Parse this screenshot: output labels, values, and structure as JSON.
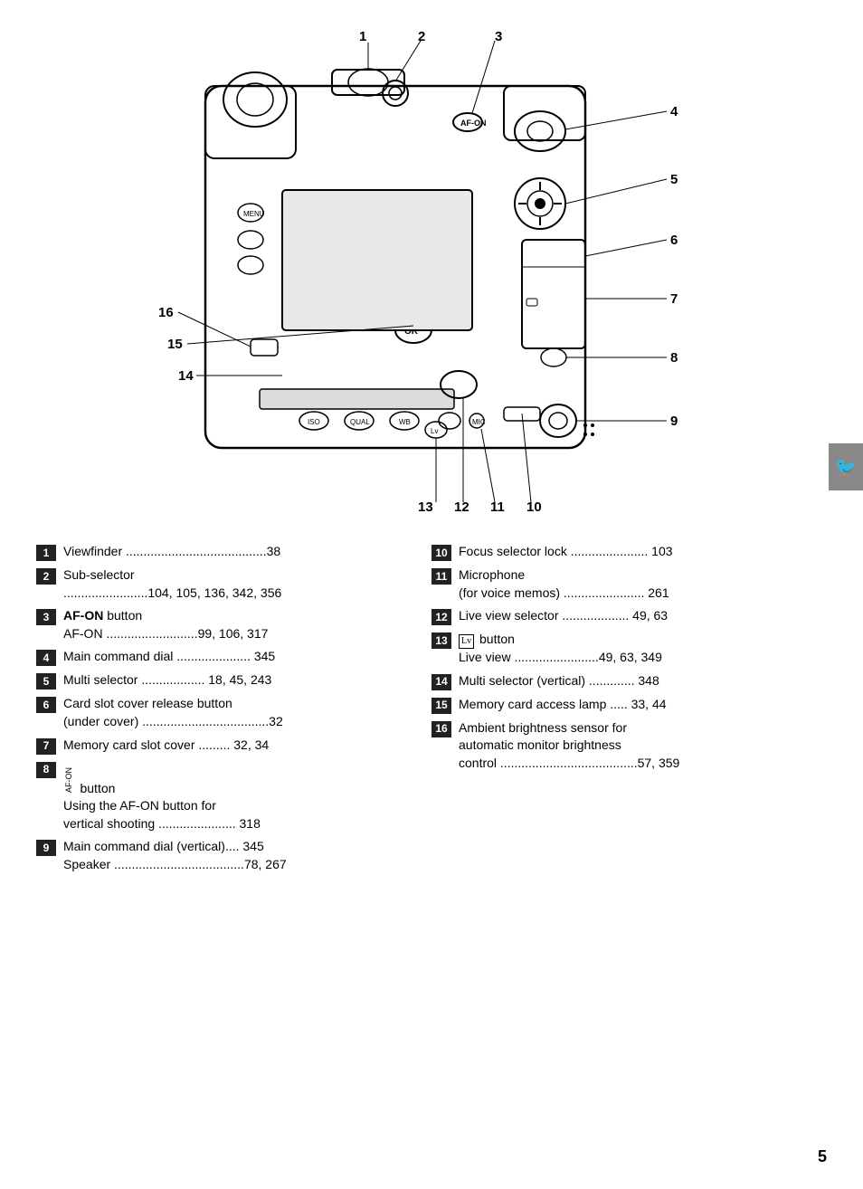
{
  "diagram": {
    "labels": [
      {
        "id": "1",
        "text": "1"
      },
      {
        "id": "2",
        "text": "2"
      },
      {
        "id": "3",
        "text": "3"
      },
      {
        "id": "4",
        "text": "4"
      },
      {
        "id": "5",
        "text": "5"
      },
      {
        "id": "6",
        "text": "6"
      },
      {
        "id": "7",
        "text": "7"
      },
      {
        "id": "8",
        "text": "8"
      },
      {
        "id": "9",
        "text": "9"
      },
      {
        "id": "10",
        "text": "10"
      },
      {
        "id": "11",
        "text": "11"
      },
      {
        "id": "12",
        "text": "12"
      },
      {
        "id": "13",
        "text": "13"
      },
      {
        "id": "14",
        "text": "14"
      },
      {
        "id": "15",
        "text": "15"
      },
      {
        "id": "16",
        "text": "16"
      }
    ]
  },
  "parts": [
    {
      "number": "1",
      "text": "Viewfinder ........................................38"
    },
    {
      "number": "2",
      "text": "Sub-selector\n........................104, 105, 136, 342, 356"
    },
    {
      "number": "3",
      "text": "AF-ON button\nAF-ON ..........................99, 106, 317",
      "bold_prefix": "AF-ON"
    },
    {
      "number": "4",
      "text": "Main command dial ..................... 345"
    },
    {
      "number": "5",
      "text": "Multi selector .................. 18, 45, 243"
    },
    {
      "number": "6",
      "text": "Card slot cover release button\n(under cover) ....................................32"
    },
    {
      "number": "7",
      "text": "Memory card slot cover ......... 32, 34"
    },
    {
      "number": "8",
      "text": "AF-ON button\nUsing the AF-ON button for\nvertical shooting ...................... 318",
      "bold_prefix": "AF-ON"
    },
    {
      "number": "9",
      "text": "Main command dial (vertical).... 345\nSpeaker .....................................78, 267"
    },
    {
      "number": "10",
      "text": "Focus selector lock ...................... 103"
    },
    {
      "number": "11",
      "text": "Microphone\n(for voice memos) ....................... 261"
    },
    {
      "number": "12",
      "text": "Live view selector ................... 49, 63"
    },
    {
      "number": "13",
      "text": "Lv button\nLive view ........................49, 63, 349",
      "lv_icon": true
    },
    {
      "number": "14",
      "text": "Multi selector (vertical) ............. 348"
    },
    {
      "number": "15",
      "text": "Memory card access lamp ..... 33, 44"
    },
    {
      "number": "16",
      "text": "Ambient brightness sensor for\nautomatic monitor brightness\ncontrol .......................................57, 359"
    }
  ],
  "page_number": "5",
  "bottom_labels": {
    "13": "13",
    "12": "12",
    "11": "11",
    "10": "10"
  }
}
